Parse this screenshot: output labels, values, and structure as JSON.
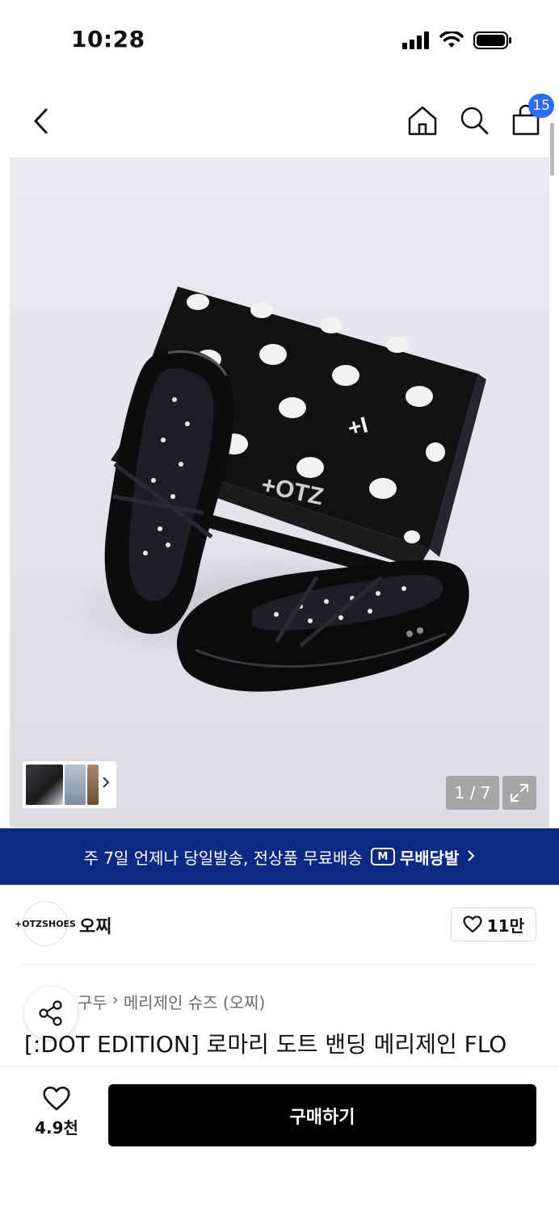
{
  "status_bar": {
    "time": "10:28",
    "icons": [
      "signal-icon",
      "wifi-icon",
      "battery-icon"
    ]
  },
  "nav": {
    "icons": [
      "back-icon",
      "home-icon",
      "search-icon",
      "cart-icon"
    ],
    "cart_count": "15"
  },
  "gallery": {
    "page_indicator": "1 / 7",
    "brand_mark_box": "+OTZ",
    "brand_mark_small": "+I"
  },
  "delivery_banner": {
    "text": "주 7일 언제나 당일발송, 전상품 무료배송",
    "badge_logo": "M",
    "badge_label": "무배당발"
  },
  "brand": {
    "logo_text": "+OTZSHOES",
    "name": "오찌",
    "like_count": "11만"
  },
  "breadcrumb": {
    "items": [
      "구두",
      "메리제인 슈즈 (오찌)"
    ]
  },
  "product": {
    "title": "[:DOT EDITION] 로마리 도트 밴딩 메리제인 FLO"
  },
  "bottom_bar": {
    "wish_count": "4.9천",
    "buy_label": "구매하기"
  },
  "colors": {
    "banner": "#0b2a83",
    "badge": "#2b6bff",
    "buy_button": "#000000"
  }
}
